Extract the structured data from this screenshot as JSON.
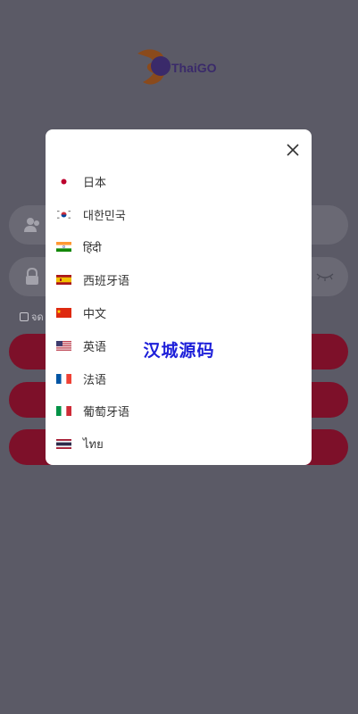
{
  "app": {
    "logo_text": "ThaiGO"
  },
  "login": {
    "remember_label": "จด"
  },
  "language_modal": {
    "close_icon": "close-icon",
    "languages": [
      {
        "label": "日本",
        "flag": "japan-flag-icon"
      },
      {
        "label": "대한민국",
        "flag": "korea-flag-icon"
      },
      {
        "label": "हिंदी",
        "flag": "india-flag-icon"
      },
      {
        "label": "西班牙语",
        "flag": "spain-flag-icon"
      },
      {
        "label": "中文",
        "flag": "china-flag-icon"
      },
      {
        "label": "英语",
        "flag": "usa-flag-icon"
      },
      {
        "label": "法语",
        "flag": "france-flag-icon"
      },
      {
        "label": "葡萄牙语",
        "flag": "italy-flag-icon"
      },
      {
        "label": "ไทย",
        "flag": "thailand-flag-icon"
      }
    ]
  },
  "watermark": "汉城源码",
  "colors": {
    "overlay_bg": "#5b5a66",
    "button": "#7d1029",
    "modal": "#ffffff",
    "watermark": "#1d1fd9"
  }
}
